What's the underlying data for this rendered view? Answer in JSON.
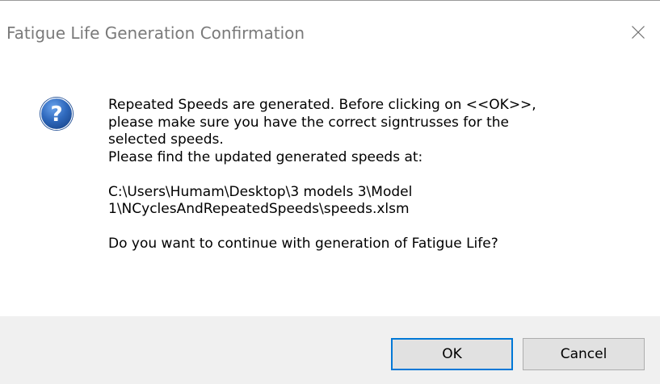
{
  "dialog": {
    "title": "Fatigue Life Generation Confirmation",
    "icon": "question-icon",
    "message_lines_1": [
      "Repeated Speeds are generated. Before clicking on <<OK>>,",
      "please make sure you have the correct signtrusses for the",
      "selected speeds.",
      "Please find the updated generated speeds at:"
    ],
    "path_lines": [
      "C:\\Users\\Humam\\Desktop\\3 models 3\\Model",
      "1\\NCyclesAndRepeatedSpeeds\\speeds.xlsm"
    ],
    "question": "Do you want to continue with generation of Fatigue Life?",
    "buttons": {
      "ok": "OK",
      "cancel": "Cancel"
    },
    "colors": {
      "title_text": "#7a7a7a",
      "footer_bg": "#f0f0f0",
      "focus_border": "#0078d7",
      "icon_blue": "#2a63b8"
    }
  }
}
